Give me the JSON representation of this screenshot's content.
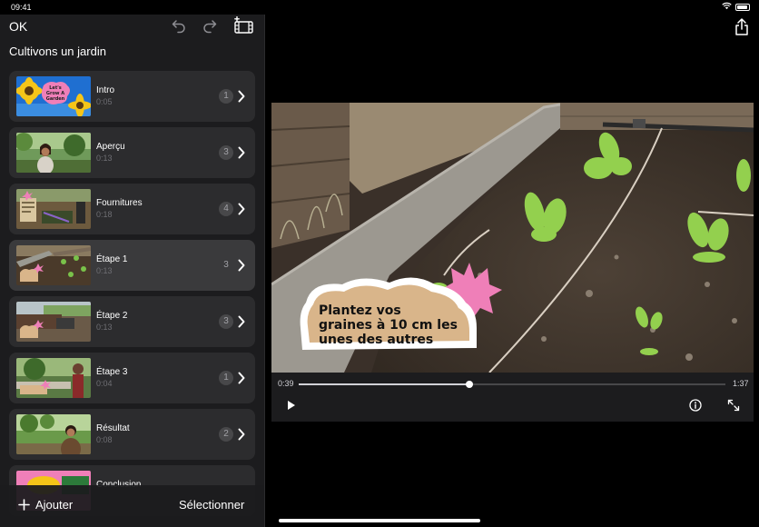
{
  "status": {
    "time": "09:41"
  },
  "sidebar": {
    "ok_label": "OK",
    "project_title": "Cultivons un jardin",
    "scenes": [
      {
        "label": "Intro",
        "duration": "0:05",
        "clips": "1"
      },
      {
        "label": "Aperçu",
        "duration": "0:13",
        "clips": "3"
      },
      {
        "label": "Fournitures",
        "duration": "0:18",
        "clips": "4"
      },
      {
        "label": "Étape 1",
        "duration": "0:13",
        "clips": "3",
        "selected": true
      },
      {
        "label": "Étape 2",
        "duration": "0:13",
        "clips": "3"
      },
      {
        "label": "Étape 3",
        "duration": "0:04",
        "clips": "1"
      },
      {
        "label": "Résultat",
        "duration": "0:08",
        "clips": "2"
      },
      {
        "label": "Conclusion",
        "duration": "",
        "clips": ""
      }
    ],
    "intro_thumb_text": [
      "Let's",
      "Grow A",
      "Garden"
    ],
    "add_label": "Ajouter",
    "select_label": "Sélectionner"
  },
  "viewer": {
    "caption_lines": [
      "Plantez vos",
      "graines à 10 cm les",
      "unes des autres"
    ],
    "current_time": "0:39",
    "total_time": "1:37",
    "progress": 0.4
  },
  "icons": [
    "undo-icon",
    "redo-icon",
    "add-clip-icon",
    "chevron-right-icon",
    "plus-icon",
    "play-icon",
    "info-icon",
    "expand-icon",
    "share-icon"
  ],
  "colors": {
    "background": "#000000",
    "sidebar": "#1c1c1e",
    "card": "#2c2c2e",
    "card_selected": "#3a3a3c",
    "sticker_pink": "#ef7fb8",
    "caption_bubble": "#d9b58a"
  }
}
